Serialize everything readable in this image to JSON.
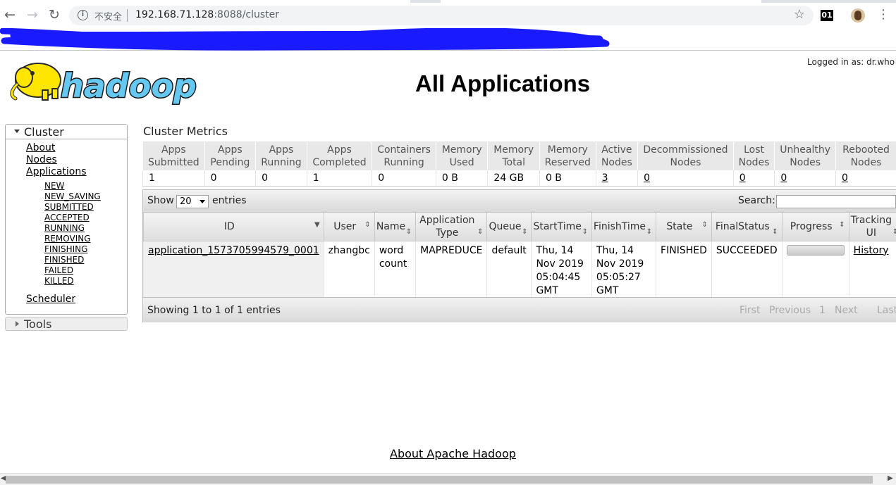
{
  "browser": {
    "security_label": "不安全",
    "url_host": "192.168.71.128",
    "url_rest": ":8088/cluster",
    "extension_badge": "01"
  },
  "header": {
    "logged_in": "Logged in as: dr.who",
    "title": "All Applications"
  },
  "sidebar": {
    "cluster_label": "Cluster",
    "links": [
      "About",
      "Nodes",
      "Applications"
    ],
    "app_states": [
      "NEW",
      "NEW_SAVING",
      "SUBMITTED",
      "ACCEPTED",
      "RUNNING",
      "REMOVING",
      "FINISHING",
      "FINISHED",
      "FAILED",
      "KILLED"
    ],
    "scheduler": "Scheduler",
    "tools_label": "Tools"
  },
  "metrics": {
    "title": "Cluster Metrics",
    "headers": [
      [
        "Apps",
        "Submitted"
      ],
      [
        "Apps",
        "Pending"
      ],
      [
        "Apps",
        "Running"
      ],
      [
        "Apps",
        "Completed"
      ],
      [
        "Containers",
        "Running"
      ],
      [
        "Memory",
        "Used"
      ],
      [
        "Memory",
        "Total"
      ],
      [
        "Memory",
        "Reserved"
      ],
      [
        "Active",
        "Nodes"
      ],
      [
        "Decommissioned",
        "Nodes"
      ],
      [
        "Lost",
        "Nodes"
      ],
      [
        "Unhealthy",
        "Nodes"
      ],
      [
        "Rebooted",
        "Nodes"
      ]
    ],
    "values": [
      "1",
      "0",
      "0",
      "1",
      "0",
      "0 B",
      "24 GB",
      "0 B",
      "3",
      "0",
      "0",
      "0",
      "0"
    ],
    "linked": [
      false,
      false,
      false,
      false,
      false,
      false,
      false,
      false,
      true,
      true,
      true,
      true,
      true
    ]
  },
  "datatable": {
    "show_label": "Show",
    "page_size": "20",
    "entries_label": "entries",
    "search_label": "Search:",
    "search_value": "",
    "columns": [
      [
        "ID"
      ],
      [
        "User"
      ],
      [
        "Name"
      ],
      [
        "Application",
        "Type"
      ],
      [
        "Queue"
      ],
      [
        "StartTime"
      ],
      [
        "FinishTime"
      ],
      [
        "State"
      ],
      [
        "FinalStatus"
      ],
      [
        "Progress"
      ],
      [
        "Tracking",
        "UI"
      ]
    ],
    "rows": [
      {
        "id": "application_1573705994579_0001",
        "user": "zhangbc",
        "name": "word count",
        "type": "MAPREDUCE",
        "queue": "default",
        "start": "Thu, 14 Nov 2019 05:04:45 GMT",
        "finish": "Thu, 14 Nov 2019 05:05:27 GMT",
        "state": "FINISHED",
        "final_status": "SUCCEEDED",
        "progress": 1.0,
        "tracking": "History"
      }
    ],
    "info": "Showing 1 to 1 of 1 entries",
    "pager": [
      "First",
      "Previous",
      "1",
      "Next",
      "Last"
    ]
  },
  "footer": {
    "about": "About Apache Hadoop"
  },
  "colors": {
    "header_bg": "#e8e8e8",
    "link": "#000000",
    "logo_yellow": "#ffe600",
    "logo_blue": "#64c8f0"
  }
}
